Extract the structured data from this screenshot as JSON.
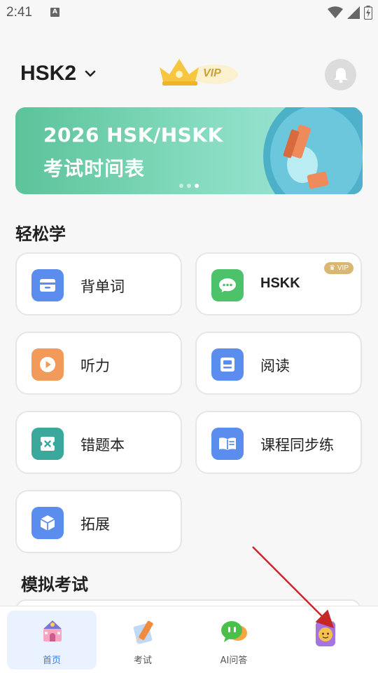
{
  "status_bar": {
    "time": "2:41",
    "notification_icon_letter": "A"
  },
  "header": {
    "title": "HSK2",
    "vip_label": "VIP"
  },
  "banner": {
    "line1": "2026 HSK/HSKK",
    "line2": "考试时间表",
    "page_count": 3,
    "active_page": 3
  },
  "sections": {
    "easy_learning": "轻松学",
    "mock_exam": "模拟考试"
  },
  "cards": [
    {
      "label": "背单词",
      "icon": "wallet-icon",
      "color": "#5b8def"
    },
    {
      "label": "HSKK",
      "icon": "chat-bubble-icon",
      "color": "#4cc26b",
      "badge": "VIP"
    },
    {
      "label": "听力",
      "icon": "play-icon",
      "color": "#f29a5a"
    },
    {
      "label": "阅读",
      "icon": "reader-icon",
      "color": "#5b8def"
    },
    {
      "label": "错题本",
      "icon": "close-box-icon",
      "color": "#3aa89b"
    },
    {
      "label": "课程同步练",
      "icon": "book-icon",
      "color": "#5b8def"
    },
    {
      "label": "拓展",
      "icon": "cube-icon",
      "color": "#5b8def"
    }
  ],
  "bottom_nav": [
    {
      "label": "首页",
      "icon": "home-castle-icon",
      "active": true
    },
    {
      "label": "考试",
      "icon": "pencil-icon",
      "active": false
    },
    {
      "label": "AI问答",
      "icon": "ai-chat-icon",
      "active": false
    },
    {
      "label": "",
      "icon": "profile-avatar-icon",
      "active": false
    }
  ],
  "colors": {
    "accent_blue": "#3b7be0",
    "vip_gold": "#d9b772",
    "banner_green": "#5cc39a",
    "annotation_arrow": "#c62828"
  }
}
